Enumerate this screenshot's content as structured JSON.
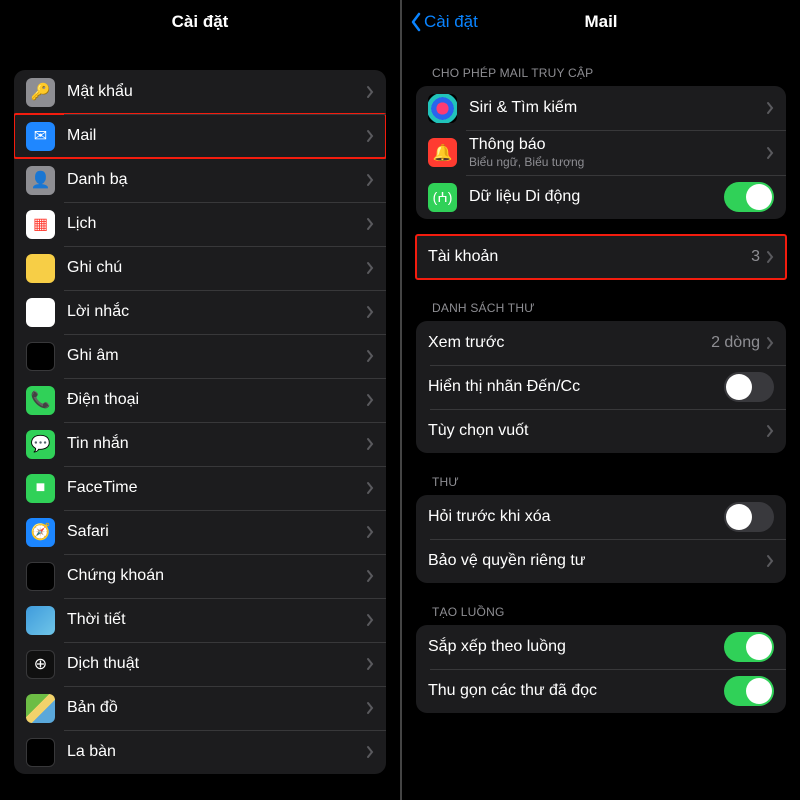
{
  "left": {
    "title": "Cài đặt",
    "items": [
      {
        "id": "passwords",
        "label": "Mật khẩu",
        "iconClass": "ic-key",
        "glyph": "🔑"
      },
      {
        "id": "mail",
        "label": "Mail",
        "iconClass": "ic-mail",
        "glyph": "✉︎",
        "highlight": true
      },
      {
        "id": "contacts",
        "label": "Danh bạ",
        "iconClass": "ic-contacts",
        "glyph": "👤"
      },
      {
        "id": "calendar",
        "label": "Lịch",
        "iconClass": "ic-cal",
        "glyph": "▦"
      },
      {
        "id": "notes",
        "label": "Ghi chú",
        "iconClass": "ic-notes",
        "glyph": ""
      },
      {
        "id": "reminders",
        "label": "Lời nhắc",
        "iconClass": "ic-rem",
        "glyph": ""
      },
      {
        "id": "voicememos",
        "label": "Ghi âm",
        "iconClass": "ic-voice",
        "glyph": ""
      },
      {
        "id": "phone",
        "label": "Điện thoại",
        "iconClass": "ic-phone",
        "glyph": "📞"
      },
      {
        "id": "messages",
        "label": "Tin nhắn",
        "iconClass": "ic-msg",
        "glyph": "💬"
      },
      {
        "id": "facetime",
        "label": "FaceTime",
        "iconClass": "ic-ft",
        "glyph": "■"
      },
      {
        "id": "safari",
        "label": "Safari",
        "iconClass": "ic-safari",
        "glyph": "🧭"
      },
      {
        "id": "stocks",
        "label": "Chứng khoán",
        "iconClass": "ic-stocks",
        "glyph": ""
      },
      {
        "id": "weather",
        "label": "Thời tiết",
        "iconClass": "ic-weather",
        "glyph": ""
      },
      {
        "id": "translate",
        "label": "Dịch thuật",
        "iconClass": "ic-trans",
        "glyph": "⊕"
      },
      {
        "id": "maps",
        "label": "Bản đồ",
        "iconClass": "ic-maps",
        "glyph": ""
      },
      {
        "id": "compass",
        "label": "La bàn",
        "iconClass": "ic-compass",
        "glyph": ""
      }
    ]
  },
  "right": {
    "back": "Cài đặt",
    "title": "Mail",
    "sections": {
      "access_header": "CHO PHÉP MAIL TRUY CẬP",
      "siri_label": "Siri & Tìm kiếm",
      "notif_label": "Thông báo",
      "notif_sub": "Biểu ngữ, Biểu tượng",
      "cellular_label": "Dữ liệu Di động",
      "cellular_on": true,
      "accounts_label": "Tài khoản",
      "accounts_value": "3",
      "list_header": "DANH SÁCH THƯ",
      "preview_label": "Xem trước",
      "preview_value": "2 dòng",
      "tocc_label": "Hiển thị nhãn Đến/Cc",
      "tocc_on": false,
      "swipe_label": "Tùy chọn vuốt",
      "mail_header": "THƯ",
      "ask_label": "Hỏi trước khi xóa",
      "ask_on": false,
      "privacy_label": "Bảo vệ quyền riêng tư",
      "thread_header": "TẠO LUỒNG",
      "org_label": "Sắp xếp theo luồng",
      "org_on": true,
      "collapse_label": "Thu gọn các thư đã đọc",
      "collapse_on": true
    }
  }
}
